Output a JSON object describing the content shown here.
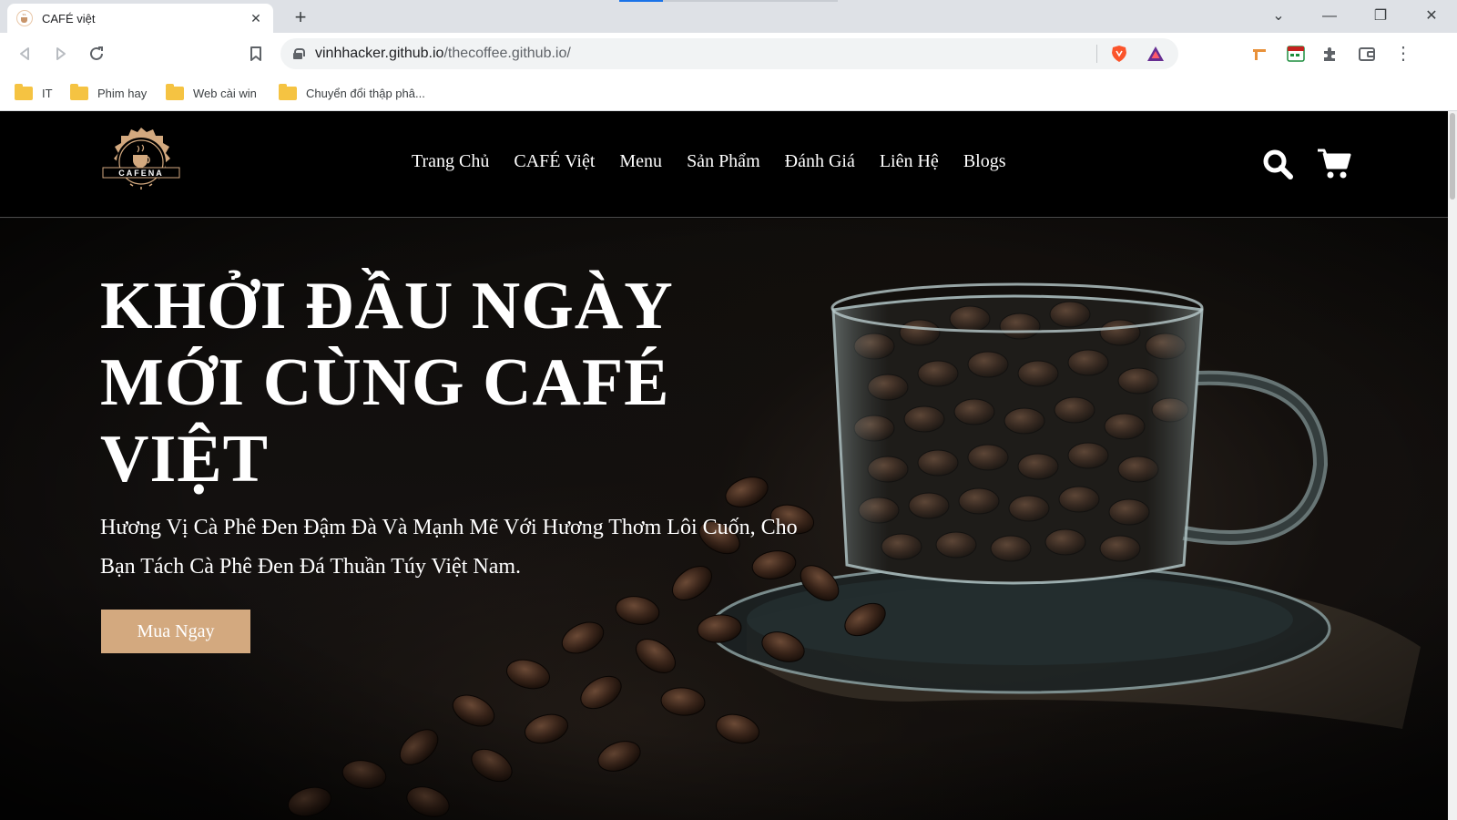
{
  "browser": {
    "tab_title": "CAFÉ việt",
    "tab_close": "✕",
    "new_tab": "+",
    "window_controls": {
      "tabs_menu": "⌄",
      "minimize": "—",
      "restore": "❐",
      "close": "✕"
    },
    "url_host": "vinhhacker.github.io",
    "url_path": "/thecoffee.github.io/",
    "bookmarks": [
      {
        "label": "IT"
      },
      {
        "label": "Phim hay"
      },
      {
        "label": "Web cài win"
      },
      {
        "label": "Chuyển đổi thập phâ..."
      }
    ],
    "menu_glyph": "⋮"
  },
  "site": {
    "logo_text": "CAFENA",
    "nav": [
      {
        "label": "Trang Chủ"
      },
      {
        "label": "CAFÉ Việt"
      },
      {
        "label": "Menu"
      },
      {
        "label": "Sản Phẩm"
      },
      {
        "label": "Đánh Giá"
      },
      {
        "label": "Liên Hệ"
      },
      {
        "label": "Blogs"
      }
    ],
    "hero": {
      "title": "KHỞI ĐẦU NGÀY MỚI CÙNG CAFÉ VIỆT",
      "subtitle": "Hương Vị Cà Phê Đen Đậm Đà Và Mạnh Mẽ Với Hương Thơm Lôi Cuốn, Cho Bạn Tách Cà Phê Đen Đá Thuần Túy Việt Nam.",
      "cta_label": "Mua Ngay"
    },
    "colors": {
      "accent": "#d3a97f",
      "header_bg": "#000000",
      "text": "#ffffff"
    }
  }
}
